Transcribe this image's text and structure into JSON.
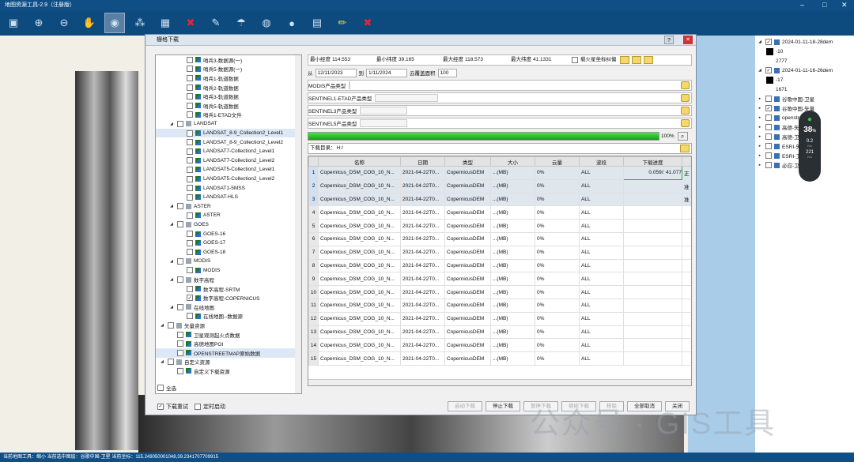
{
  "app": {
    "title": "地图资源工具-2.9（注册版）",
    "status": "当前地图工具：缩小 当前选中图层：谷歌中国-卫星 当前坐标：115.249050001048,39.2341707709915"
  },
  "layers": [
    {
      "label": "2024-01-11-18-28dem",
      "checked": true,
      "expand": true
    },
    {
      "label": "-10",
      "swatch": "#000000"
    },
    {
      "label": "2777",
      "swatch": ""
    },
    {
      "label": "2024-01-11-16-26dem",
      "checked": true,
      "expand": true
    },
    {
      "label": "-17",
      "swatch": "#000000"
    },
    {
      "label": "1671",
      "swatch": ""
    },
    {
      "label": "谷歌中国-卫星",
      "checked": false
    },
    {
      "label": "谷歌中国-矢量",
      "checked": true
    },
    {
      "label": "openstreetmap",
      "checked": false
    },
    {
      "label": "高德-矢",
      "checked": false
    },
    {
      "label": "高德-卫",
      "checked": false
    },
    {
      "label": "ESRI-矢",
      "checked": false
    },
    {
      "label": "ESRI-卫",
      "checked": false
    },
    {
      "label": "必应-卫",
      "checked": false
    }
  ],
  "gauge": {
    "value": "38",
    "unit": "%",
    "up": "0.2",
    "down": "221",
    "speed_unit": "K/s"
  },
  "dialog": {
    "title": "栅格下载",
    "help": "?",
    "close": "✕",
    "tree": [
      {
        "label": "哨兵3-数据源(一)",
        "lvl": 2,
        "checked": false,
        "icon": "sat"
      },
      {
        "label": "哨兵5-数据源(一)",
        "lvl": 2,
        "checked": false,
        "icon": "sat"
      },
      {
        "label": "哨兵1-轨道数据",
        "lvl": 2,
        "checked": false,
        "icon": "sat"
      },
      {
        "label": "哨兵2-轨道数据",
        "lvl": 2,
        "checked": false,
        "icon": "sat"
      },
      {
        "label": "哨兵3-轨道数据",
        "lvl": 2,
        "checked": false,
        "icon": "sat"
      },
      {
        "label": "哨兵5-轨道数据",
        "lvl": 2,
        "checked": false,
        "icon": "sat"
      },
      {
        "label": "哨兵1-ETAD文件",
        "lvl": 2,
        "checked": false,
        "icon": "sat"
      },
      {
        "label": "LANDSAT",
        "lvl": 1,
        "checked": false,
        "icon": "folder",
        "expand": true
      },
      {
        "label": "LANDSAT_8-9_Collection2_Level1",
        "lvl": 2,
        "checked": false,
        "icon": "sat",
        "selected": true
      },
      {
        "label": "LANDSAT_8-9_Collection2_Level2",
        "lvl": 2,
        "checked": false,
        "icon": "sat"
      },
      {
        "label": "LANDSAT7-Collection2_Level1",
        "lvl": 2,
        "checked": false,
        "icon": "sat"
      },
      {
        "label": "LANDSAT7-Collection2_Level2",
        "lvl": 2,
        "checked": false,
        "icon": "sat"
      },
      {
        "label": "LANDSAT5-Collection2_Level1",
        "lvl": 2,
        "checked": false,
        "icon": "sat"
      },
      {
        "label": "LANDSAT5-Collection2_Level2",
        "lvl": 2,
        "checked": false,
        "icon": "sat"
      },
      {
        "label": "LANDSAT1-5MSS",
        "lvl": 2,
        "checked": false,
        "icon": "sat"
      },
      {
        "label": "LANDSAT-HLS",
        "lvl": 2,
        "checked": false,
        "icon": "sat"
      },
      {
        "label": "ASTER",
        "lvl": 1,
        "checked": false,
        "icon": "folder",
        "expand": true
      },
      {
        "label": "ASTER",
        "lvl": 2,
        "checked": false,
        "icon": "sat"
      },
      {
        "label": "GOES",
        "lvl": 1,
        "checked": false,
        "icon": "folder",
        "expand": true
      },
      {
        "label": "GOES-16",
        "lvl": 2,
        "checked": false,
        "icon": "sat"
      },
      {
        "label": "GOES-17",
        "lvl": 2,
        "checked": false,
        "icon": "sat"
      },
      {
        "label": "GOES-18",
        "lvl": 2,
        "checked": false,
        "icon": "sat"
      },
      {
        "label": "MODIS",
        "lvl": 1,
        "checked": false,
        "icon": "folder",
        "expand": true
      },
      {
        "label": "MODIS",
        "lvl": 2,
        "checked": false,
        "icon": "sat"
      },
      {
        "label": "数字高程",
        "lvl": 1,
        "checked": false,
        "icon": "folder",
        "expand": true
      },
      {
        "label": "数字高程-SRTM",
        "lvl": 2,
        "checked": false,
        "icon": "sat"
      },
      {
        "label": "数字高程-COPERNICUS",
        "lvl": 2,
        "checked": true,
        "icon": "sat"
      },
      {
        "label": "在线地图",
        "lvl": 1,
        "checked": false,
        "icon": "folder",
        "expand": true
      },
      {
        "label": "在线地图--数据源",
        "lvl": 2,
        "checked": false,
        "icon": "sat"
      },
      {
        "label": "矢量资源",
        "lvl": 0,
        "checked": false,
        "icon": "folder",
        "expand": true
      },
      {
        "label": "卫星观测起火点数据",
        "lvl": 1,
        "checked": false,
        "icon": "sat"
      },
      {
        "label": "高德地图POI",
        "lvl": 1,
        "checked": false,
        "icon": "sat"
      },
      {
        "label": "OPENSTREETMAP原始数据",
        "lvl": 1,
        "checked": false,
        "icon": "sat",
        "selected": true
      },
      {
        "label": "自定义资源",
        "lvl": 0,
        "checked": false,
        "icon": "folder",
        "expand": true
      },
      {
        "label": "自定义下载资源",
        "lvl": 1,
        "checked": false,
        "icon": "sat"
      }
    ],
    "select_all": "全选",
    "bounds": {
      "minlon_l": "最小经度",
      "minlon": "114.553",
      "minlat_l": "最小纬度",
      "minlat": "39.165",
      "maxlon_l": "最大经度",
      "maxlon": "118.573",
      "maxlat_l": "最大纬度",
      "maxlat": "41.1331",
      "fire_l": "载火星坐标纠偏"
    },
    "date": {
      "from_l": "从",
      "from": "12/11/2023",
      "to_l": "到",
      "to": "1/11/2024",
      "cloud_l": "云覆盖面积",
      "cloud": "100"
    },
    "ptypes": [
      {
        "label": "MODIS产品类型"
      },
      {
        "label": "SENTINEL1-ETAD产品类型"
      },
      {
        "label": "SENTINEL3产品类型"
      },
      {
        "label": "SENTINEL5产品类型"
      }
    ],
    "progress": {
      "value": 100,
      "text": "100%"
    },
    "dir": {
      "label": "下载目录",
      "value": "H:/"
    },
    "table": {
      "headers": [
        "名称",
        "日期",
        "类型",
        "大小",
        "云量",
        "波段",
        "下载进度"
      ],
      "rows": [
        {
          "n": "1",
          "name": "Copernicus_DSM_COG_10_N...",
          "date": "2021-04-22T0...",
          "type": "CopernicusDEM",
          "size": "...(MB)",
          "cloud": "0%",
          "band": "ALL",
          "prog": "0.059/:  41.077",
          "extra": "正"
        },
        {
          "n": "2",
          "name": "Copernicus_DSM_COG_10_N...",
          "date": "2021-04-22T0...",
          "type": "CopernicusDEM",
          "size": "...(MB)",
          "cloud": "0%",
          "band": "ALL",
          "prog": "",
          "extra": "准"
        },
        {
          "n": "3",
          "name": "Copernicus_DSM_COG_10_N...",
          "date": "2021-04-22T0...",
          "type": "CopernicusDEM",
          "size": "...(MB)",
          "cloud": "0%",
          "band": "ALL",
          "prog": "",
          "extra": "准"
        },
        {
          "n": "4",
          "name": "Copernicus_DSM_COG_10_N...",
          "date": "2021-04-22T0...",
          "type": "CopernicusDEM",
          "size": "...(MB)",
          "cloud": "0%",
          "band": "ALL",
          "prog": "",
          "extra": ""
        },
        {
          "n": "5",
          "name": "Copernicus_DSM_COG_10_N...",
          "date": "2021-04-22T0...",
          "type": "CopernicusDEM",
          "size": "...(MB)",
          "cloud": "0%",
          "band": "ALL",
          "prog": "",
          "extra": ""
        },
        {
          "n": "6",
          "name": "Copernicus_DSM_COG_10_N...",
          "date": "2021-04-22T0...",
          "type": "CopernicusDEM",
          "size": "...(MB)",
          "cloud": "0%",
          "band": "ALL",
          "prog": "",
          "extra": ""
        },
        {
          "n": "7",
          "name": "Copernicus_DSM_COG_10_N...",
          "date": "2021-04-22T0...",
          "type": "CopernicusDEM",
          "size": "...(MB)",
          "cloud": "0%",
          "band": "ALL",
          "prog": "",
          "extra": ""
        },
        {
          "n": "8",
          "name": "Copernicus_DSM_COG_10_N...",
          "date": "2021-04-22T0...",
          "type": "CopernicusDEM",
          "size": "...(MB)",
          "cloud": "0%",
          "band": "ALL",
          "prog": "",
          "extra": ""
        },
        {
          "n": "9",
          "name": "Copernicus_DSM_COG_10_N...",
          "date": "2021-04-22T0...",
          "type": "CopernicusDEM",
          "size": "...(MB)",
          "cloud": "0%",
          "band": "ALL",
          "prog": "",
          "extra": ""
        },
        {
          "n": "10",
          "name": "Copernicus_DSM_COG_10_N...",
          "date": "2021-04-22T0...",
          "type": "CopernicusDEM",
          "size": "...(MB)",
          "cloud": "0%",
          "band": "ALL",
          "prog": "",
          "extra": ""
        },
        {
          "n": "11",
          "name": "Copernicus_DSM_COG_10_N...",
          "date": "2021-04-22T0...",
          "type": "CopernicusDEM",
          "size": "...(MB)",
          "cloud": "0%",
          "band": "ALL",
          "prog": "",
          "extra": ""
        },
        {
          "n": "12",
          "name": "Copernicus_DSM_COG_10_N...",
          "date": "2021-04-22T0...",
          "type": "CopernicusDEM",
          "size": "...(MB)",
          "cloud": "0%",
          "band": "ALL",
          "prog": "",
          "extra": ""
        },
        {
          "n": "13",
          "name": "Copernicus_DSM_COG_10_N...",
          "date": "2021-04-22T0...",
          "type": "CopernicusDEM",
          "size": "...(MB)",
          "cloud": "0%",
          "band": "ALL",
          "prog": "",
          "extra": ""
        },
        {
          "n": "14",
          "name": "Copernicus_DSM_COG_10_N...",
          "date": "2021-04-22T0...",
          "type": "CopernicusDEM",
          "size": "...(MB)",
          "cloud": "0%",
          "band": "ALL",
          "prog": "",
          "extra": ""
        },
        {
          "n": "15",
          "name": "Copernicus_DSM_COG_10_N...",
          "date": "2021-04-22T0...",
          "type": "CopernicusDEM",
          "size": "...(MB)",
          "cloud": "0%",
          "band": "ALL",
          "prog": "",
          "extra": ""
        }
      ]
    },
    "opts": {
      "retry": "下载重试",
      "retry_checked": true,
      "timer": "定时启动",
      "timer_checked": false
    },
    "buttons": {
      "start": "启动下载",
      "stop": "停止下载",
      "pause": "暂停下载",
      "resume": "继续下载",
      "remove": "移除",
      "cancel_all": "全部取消",
      "close": "关闭"
    }
  },
  "watermark": "公众号 · GIS工具",
  "colors": {
    "titlebar": "#0f4f86",
    "progress": "#1fbf1f",
    "accent": "#f5d76e"
  }
}
